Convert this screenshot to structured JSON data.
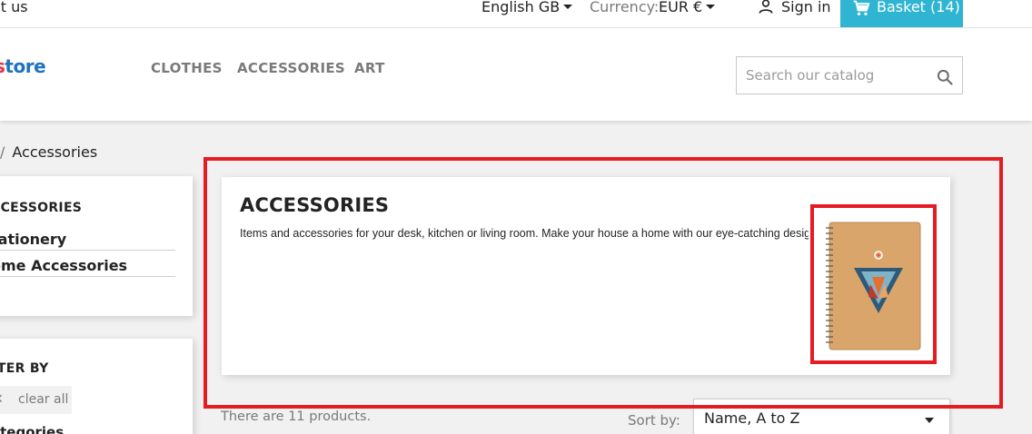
{
  "topbar": {
    "contact": "ct us",
    "language": "English GB",
    "currency_label": "Currency:",
    "currency_value": "EUR €",
    "sign_in": "Sign in",
    "basket": "Basket (14)"
  },
  "header": {
    "logo_part1": "s",
    "logo_part2": "tore",
    "nav": [
      "CLOTHES",
      "ACCESSORIES",
      "ART"
    ],
    "search_placeholder": "Search our catalog"
  },
  "breadcrumb": {
    "separator": "/",
    "current": "Accessories"
  },
  "sidebar": {
    "category_title": "CCESSORIES",
    "categories": [
      "tationery",
      "ome Accessories"
    ],
    "filter_title": "LTER BY",
    "clear_all": "clear all",
    "facet_label": "ategories"
  },
  "category_block": {
    "title": "ACCESSORIES",
    "description": "Items and accessories for your desk, kitchen or living room. Make your house a home with our eye-catching designs."
  },
  "products": {
    "count_text": "There are 11 products.",
    "sort_label": "Sort by:",
    "sort_value": "Name, A to Z"
  },
  "colors": {
    "accent": "#2fb5d2",
    "annotation": "#e51c23",
    "logo_red": "#e9324b",
    "logo_blue": "#1e73be"
  },
  "icons": {
    "user": "user-icon",
    "cart": "cart-icon",
    "search": "search-icon",
    "caret": "caret-down-icon",
    "close": "close-icon"
  }
}
